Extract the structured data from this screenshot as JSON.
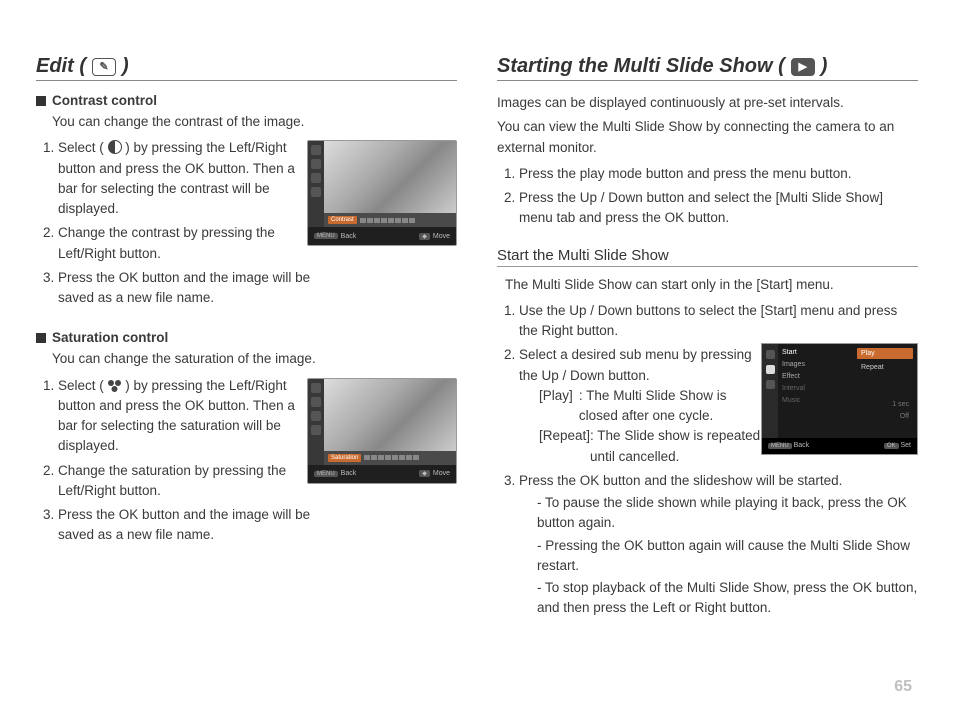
{
  "page_number": "65",
  "left": {
    "heading": "Edit (",
    "heading_close": ")",
    "contrast": {
      "title": "Contrast control",
      "intro": "You can change the contrast of the image.",
      "steps": [
        "Select (  ) by pressing the Left/Right button and press the OK button. Then a bar for selecting the contrast will be displayed.",
        "Change the contrast by pressing the Left/Right button.",
        "Press the OK button and the image will be saved as a new file name."
      ],
      "thumb": {
        "tag": "Contrast",
        "back": "Back",
        "move": "Move",
        "menu_key": "MENU"
      }
    },
    "saturation": {
      "title": "Saturation control",
      "intro": "You can change the saturation of the image.",
      "steps": [
        "Select (  ) by pressing the Left/Right button and press the OK button. Then a bar for selecting the saturation will be displayed.",
        "Change the saturation by pressing the Left/Right button.",
        "Press the OK button and the image will be saved as a new file name."
      ],
      "thumb": {
        "tag": "Saturation",
        "back": "Back",
        "move": "Move",
        "menu_key": "MENU"
      }
    }
  },
  "right": {
    "heading": "Starting the Multi Slide Show (",
    "heading_close": ")",
    "intro1": "Images can be displayed continuously at pre-set intervals.",
    "intro2": "You can view the Multi Slide Show by connecting the camera to an external monitor.",
    "pre_steps": [
      "Press the play mode button and press the menu button.",
      "Press the Up / Down button and select the [Multi Slide Show] menu tab and press the OK button."
    ],
    "sub_heading": "Start the Multi Slide Show",
    "sub_intro": "The Multi Slide Show can start only in the [Start] menu.",
    "step1": "Use the Up / Down buttons to select the [Start] menu and press the Right button.",
    "step2_lead": "Select a desired sub menu by pressing the Up / Down button.",
    "play_label": "[Play]",
    "play_desc": ": The Multi Slide Show is closed after one cycle.",
    "repeat_label": "[Repeat]",
    "repeat_desc": ": The Slide show is repeated until cancelled.",
    "step3_lead": "Press the OK button and the slideshow will be started.",
    "dash1": "- To pause the slide shown while playing it back, press the OK button again.",
    "dash2": "- Pressing the OK button again will cause the Multi Slide Show restart.",
    "dash3": "- To stop playback of the Multi Slide Show, press the OK button, and then press the Left or Right button.",
    "menu_thumb": {
      "items": [
        "Start",
        "Images",
        "Effect",
        "Interval",
        "Music"
      ],
      "opts": [
        "Play",
        "Repeat"
      ],
      "interval_val": "1 sec",
      "music_val": "Off",
      "back": "Back",
      "set": "Set",
      "menu_key": "MENU",
      "ok_key": "OK"
    }
  }
}
